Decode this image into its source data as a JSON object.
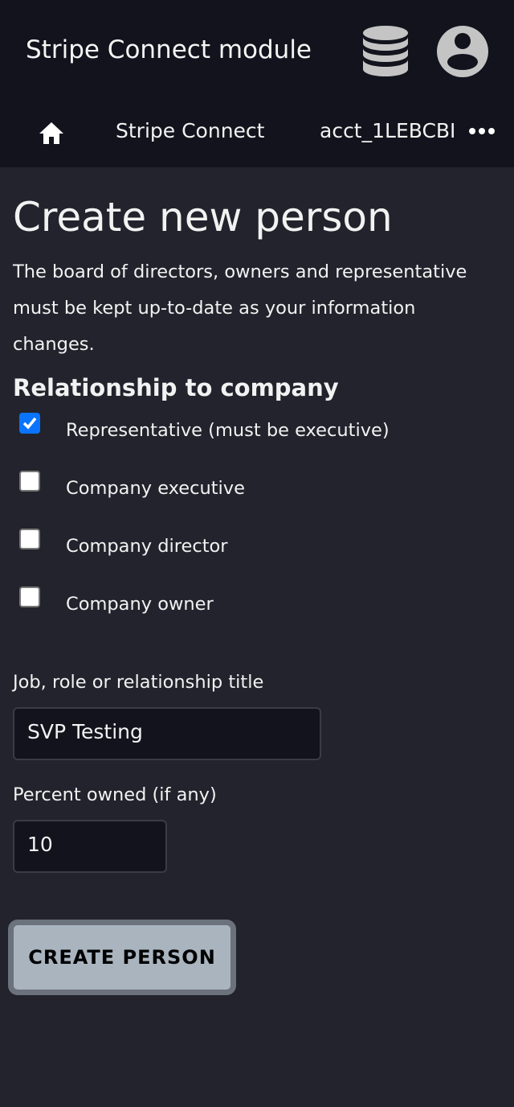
{
  "header": {
    "title": "Stripe Connect module",
    "icons": [
      "database-icon",
      "account-icon"
    ]
  },
  "breadcrumb": {
    "items": [
      "Stripe Connect",
      "acct_1LEBCBI"
    ]
  },
  "page": {
    "title": "Create new person",
    "description": "The board of directors, owners and representative must be kept up-to-date as your information changes.",
    "section_title": "Relationship to company",
    "checkboxes": [
      {
        "label": "Representative (must be executive)",
        "checked": true
      },
      {
        "label": "Company executive",
        "checked": false
      },
      {
        "label": "Company director",
        "checked": false
      },
      {
        "label": "Company owner",
        "checked": false
      }
    ],
    "job_title": {
      "label": "Job, role or relationship title",
      "value": "SVP Testing"
    },
    "percent": {
      "label": "Percent owned (if any)",
      "value": "10"
    },
    "submit_label": "CREATE PERSON"
  },
  "colors": {
    "accent": "#0a74ff",
    "header_bg": "#12131c",
    "body_bg": "#22232c"
  }
}
